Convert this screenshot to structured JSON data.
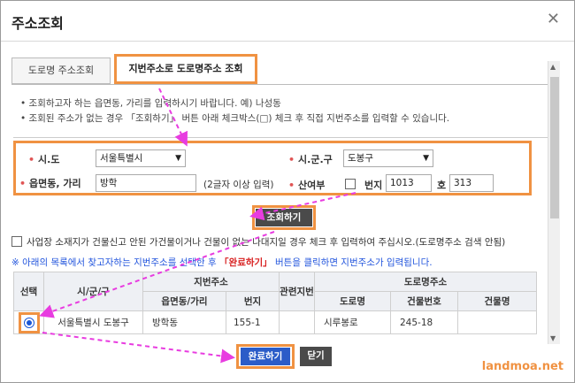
{
  "dialog": {
    "title": "주소조회",
    "close_icon": "close-icon"
  },
  "tabs": [
    {
      "label": "도로명 주소조회"
    },
    {
      "label": "지번주소로 도로명주소 조회"
    }
  ],
  "info": {
    "line1": "조회하고자 하는 읍면동, 가리를 입력하시기 바랍니다. 예) 나성동",
    "line2": "조회된 주소가 없는 경우 「조회하기」 버튼 아래 체크박스(□) 체크 후 직접 지번주소를 입력할 수 있습니다."
  },
  "form": {
    "sido_label": "시.도",
    "sido_value": "서울특별시",
    "sigungu_label": "시.군.구",
    "sigungu_value": "도봉구",
    "eupmyeon_label": "읍면동, 가리",
    "eupmyeon_value": "방학",
    "eupmyeon_hint": "(2글자 이상 입력)",
    "san_label": "산여부",
    "bunji_label": "번지",
    "bunji_value": "1013",
    "ho_label": "호",
    "ho_value": "313"
  },
  "search_button": "조회하기",
  "manual_check_label": "사업장 소재지가 건물신고 안된 가건물이거나 건물이 없는 나대지일 경우 체크 후 입력하여 주십시오.(도로명주소 검색 안됨)",
  "notice": {
    "part1": "※ 아래의 목록에서 찾고자하는 지번주소를 선택한 후",
    "highlight": "「완료하기」",
    "part2": "버튼을 클릭하면 지번주소가 입력됩니다."
  },
  "table": {
    "headers": {
      "select": "선택",
      "sigungu": "시/군/구",
      "jibun_group": "지번주소",
      "related": "관련지번",
      "road_group": "도로명주소",
      "eupmyeon": "읍면동/가리",
      "bunji": "번지",
      "road": "도로명",
      "building_no": "건물번호",
      "building_name": "건물명"
    },
    "row": {
      "sigungu": "서울특별시 도봉구",
      "eupmyeon": "방학동",
      "bunji": "155-1",
      "related": "",
      "road": "시루봉로",
      "building_no": "245-18",
      "building_name": ""
    }
  },
  "buttons": {
    "complete": "완료하기",
    "close": "닫기"
  },
  "watermark": "landmoa.net",
  "colors": {
    "highlight": "#f09242",
    "arrow": "#e83ce0",
    "primary": "#2b5cc8"
  }
}
